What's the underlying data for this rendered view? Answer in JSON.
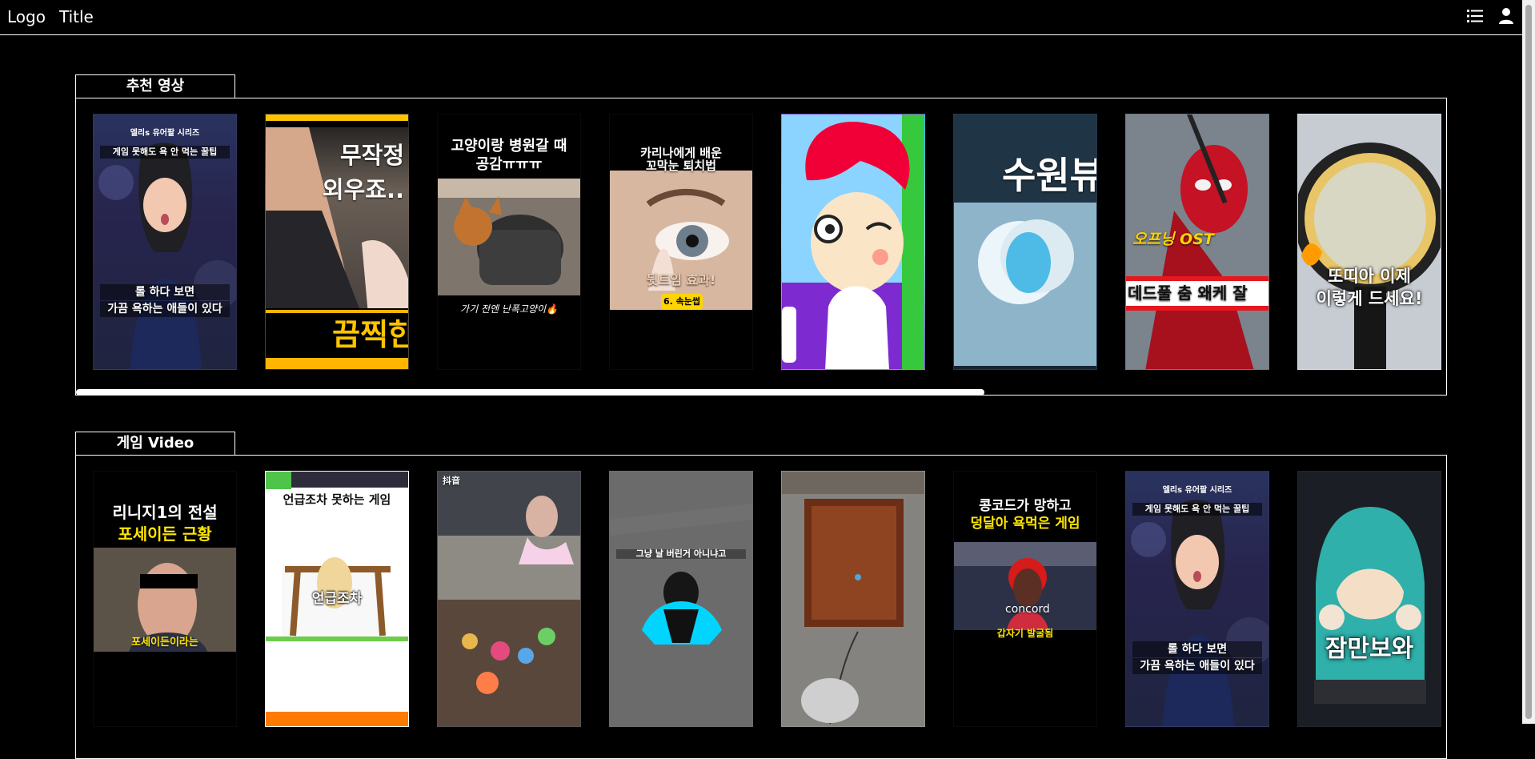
{
  "header": {
    "logo": "Logo",
    "title": "Title"
  },
  "icons": {
    "list": "list-icon",
    "user": "user-icon"
  },
  "sections": {
    "recommended": {
      "label": "추천 영상",
      "cards": [
        {
          "line1": "엘리s 유어팔 시리즈",
          "line2": "게임 못해도 욕 안 먹는 꿀팁",
          "line3": "롤 하다 보면",
          "line4": "가끔 욕하는 애들이 있다"
        },
        {
          "line1": "무작정",
          "line2": "외우죠..",
          "line3": "끔찍한"
        },
        {
          "line1": "고양이랑 병원갈 때",
          "line2": "공감ㅠㅠㅠ",
          "line3": "가기 전엔 난폭고양이🔥"
        },
        {
          "line1": "카리나에게 배운",
          "line2": "꼬막눈 퇴치법",
          "line3": "뒷트임 효과!",
          "line4": "6. 속눈썹"
        },
        {},
        {
          "line1": "수원뷰"
        },
        {
          "line1": "오프닝 OST",
          "line2": "데드풀 춤 왜케 잘"
        },
        {
          "line1": "또띠아 이제",
          "line2": "이렇게 드세요!"
        }
      ]
    },
    "game": {
      "label": "게임 Video",
      "cards": [
        {
          "line1": "리니지1의 전설",
          "line2": "포세이든 근황",
          "line3": "포세이든이라는"
        },
        {
          "line1": "언급조차 못하는 게임",
          "line2": "언급조차"
        },
        {
          "line1": "抖音"
        },
        {
          "line1": "그냥 날 버린거 아니냐고"
        },
        {},
        {
          "line1": "콩코드가 망하고",
          "line2": "덩달아 욕먹은 게임",
          "line3": "concord",
          "line4": "갑자기 발굴됨"
        },
        {
          "line1": "엘리s 유어팔 시리즈",
          "line2": "게임 못해도 욕 안 먹는 꿀팁",
          "line3": "롤 하다 보면",
          "line4": "가끔 욕하는 애들이 있다"
        },
        {
          "line1": "잠만보와"
        }
      ]
    }
  },
  "scroll": {
    "recommended_position": 0,
    "recommended_visible_fraction": 0.66
  },
  "colors": {
    "background": "#000000",
    "border": "#ffffff",
    "accent_yellow": "#ffd400",
    "orange": "#ff8c00",
    "red": "#e5171f"
  }
}
